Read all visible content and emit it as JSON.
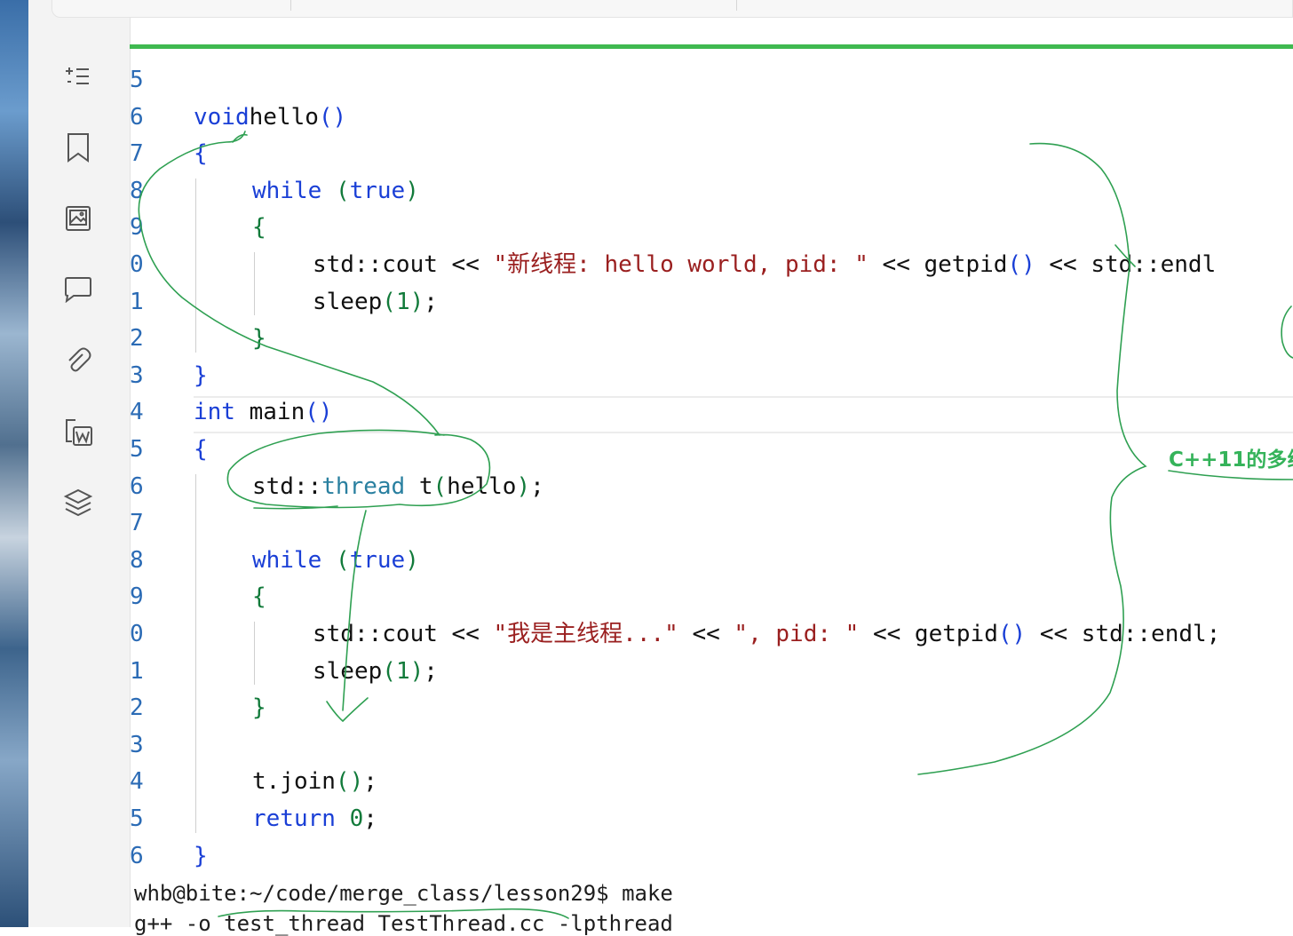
{
  "toolbar": {
    "tools": [
      {
        "name": "sparkle-list-icon"
      },
      {
        "name": "bookmark-icon"
      },
      {
        "name": "image-icon"
      },
      {
        "name": "comment-icon"
      },
      {
        "name": "paperclip-icon"
      },
      {
        "name": "word-export-icon"
      },
      {
        "name": "layers-icon"
      }
    ]
  },
  "editor": {
    "line_numbers": [
      "5",
      "6",
      "7",
      "8",
      "9",
      "0",
      "1",
      "2",
      "3",
      "4",
      "5",
      "6",
      "7",
      "8",
      "9",
      "0",
      "1",
      "2",
      "3",
      "4",
      "5",
      "6"
    ],
    "lines": [
      {
        "parts": []
      },
      {
        "parts": [
          [
            "kw",
            "void"
          ],
          [
            "",
            "hello"
          ],
          [
            "par",
            "()"
          ]
        ]
      },
      {
        "parts": [
          [
            "par",
            "{"
          ]
        ]
      },
      {
        "parts": [
          [
            "kw",
            "while"
          ],
          [
            "",
            " "
          ],
          [
            "g",
            "("
          ],
          [
            "kw",
            "true"
          ],
          [
            "g",
            ")"
          ]
        ]
      },
      {
        "parts": [
          [
            "g",
            "{"
          ]
        ]
      },
      {
        "parts": [
          [
            "",
            "std::cout "
          ],
          [
            "",
            "<< "
          ],
          [
            "str",
            "\"新线程: hello world, pid: \""
          ],
          [
            "",
            " << getpid"
          ],
          [
            "par",
            "()"
          ],
          [
            "",
            " << std::endl"
          ]
        ]
      },
      {
        "parts": [
          [
            "",
            "sleep"
          ],
          [
            "g",
            "("
          ],
          [
            "num",
            "1"
          ],
          [
            "g",
            ")"
          ],
          [
            "",
            ";"
          ]
        ]
      },
      {
        "parts": [
          [
            "g",
            "}"
          ]
        ]
      },
      {
        "parts": [
          [
            "par",
            "}"
          ]
        ]
      },
      {
        "parts": [
          [
            "kw",
            "int"
          ],
          [
            "",
            " main"
          ],
          [
            "par",
            "()"
          ]
        ]
      },
      {
        "parts": [
          [
            "par",
            "{"
          ]
        ]
      },
      {
        "parts": [
          [
            "",
            "std::"
          ],
          [
            "cls",
            "thread"
          ],
          [
            "",
            " t"
          ],
          [
            "g",
            "("
          ],
          [
            "",
            "hello"
          ],
          [
            "g",
            ")"
          ],
          [
            "",
            ";"
          ]
        ]
      },
      {
        "parts": []
      },
      {
        "parts": [
          [
            "kw",
            "while"
          ],
          [
            "",
            " "
          ],
          [
            "g",
            "("
          ],
          [
            "kw",
            "true"
          ],
          [
            "g",
            ")"
          ]
        ]
      },
      {
        "parts": [
          [
            "g",
            "{"
          ]
        ]
      },
      {
        "parts": [
          [
            "",
            "std::cout "
          ],
          [
            "",
            "<< "
          ],
          [
            "str",
            "\"我是主线程...\""
          ],
          [
            "",
            " << "
          ],
          [
            "str",
            "\", pid: \""
          ],
          [
            "",
            " << getpid"
          ],
          [
            "par",
            "()"
          ],
          [
            "",
            " << std::endl;"
          ]
        ]
      },
      {
        "parts": [
          [
            "",
            "sleep"
          ],
          [
            "g",
            "("
          ],
          [
            "num",
            "1"
          ],
          [
            "g",
            ")"
          ],
          [
            "",
            ";"
          ]
        ]
      },
      {
        "parts": [
          [
            "g",
            "}"
          ]
        ]
      },
      {
        "parts": []
      },
      {
        "parts": [
          [
            "",
            "t.join"
          ],
          [
            "g",
            "()"
          ],
          [
            "",
            ";"
          ]
        ]
      },
      {
        "parts": [
          [
            "kw",
            "return"
          ],
          [
            "",
            " "
          ],
          [
            "num",
            "0"
          ],
          [
            "",
            ";"
          ]
        ]
      },
      {
        "parts": [
          [
            "par",
            "}"
          ]
        ]
      }
    ],
    "indents": [
      0,
      0,
      0,
      1,
      1,
      2,
      2,
      1,
      0,
      0,
      0,
      1,
      1,
      1,
      1,
      2,
      2,
      1,
      1,
      1,
      1,
      0
    ]
  },
  "terminal": {
    "prompt_line": "whb@bite:~/code/merge_class/lesson29$ make",
    "compile_line": "g++ -o test_thread TestThread.cc -lpthread"
  },
  "annotation": {
    "note_text": "C++11的多线"
  },
  "colors": {
    "accent": "#3fb950",
    "keyword": "#1a3fd6",
    "string": "#9a1f1f",
    "line_number": "#2b6bb5",
    "ink": "#2fa052"
  }
}
